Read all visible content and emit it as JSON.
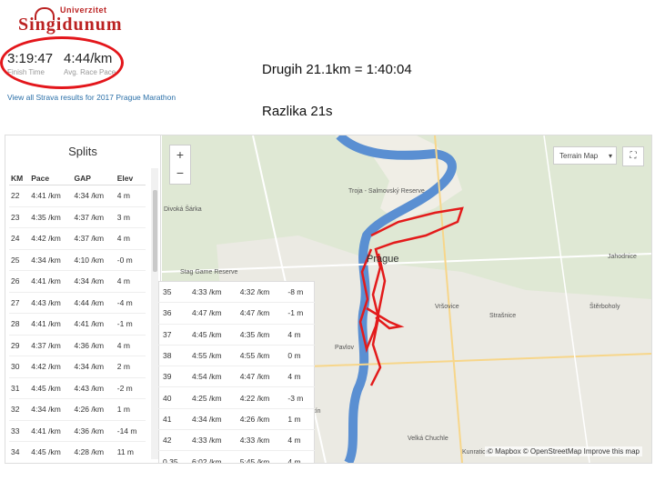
{
  "logo": {
    "top": "Univerzitet",
    "main": "Singidunum"
  },
  "finish": {
    "value": "3:19:47",
    "label": "Finish Time"
  },
  "pace": {
    "value": "4:44/km",
    "label": "Avg. Race Pace"
  },
  "strava_link": "View all Strava results for 2017 Prague Marathon",
  "heading1": "Drugih 21.1km = 1:40:04",
  "heading2": "Razlika 21s",
  "splits": {
    "title": "Splits",
    "columns": [
      "KM",
      "Pace",
      "GAP",
      "Elev"
    ],
    "rows": [
      [
        "22",
        "4:41 /km",
        "4:34 /km",
        "4 m"
      ],
      [
        "23",
        "4:35 /km",
        "4:37 /km",
        "3 m"
      ],
      [
        "24",
        "4:42 /km",
        "4:37 /km",
        "4 m"
      ],
      [
        "25",
        "4:34 /km",
        "4:10 /km",
        "-0 m"
      ],
      [
        "26",
        "4:41 /km",
        "4:34 /km",
        "4 m"
      ],
      [
        "27",
        "4:43 /km",
        "4:44 /km",
        "-4 m"
      ],
      [
        "28",
        "4:41 /km",
        "4:41 /km",
        "-1 m"
      ],
      [
        "29",
        "4:37 /km",
        "4:36 /km",
        "4 m"
      ],
      [
        "30",
        "4:42 /km",
        "4:34 /km",
        "2 m"
      ],
      [
        "31",
        "4:45 /km",
        "4:43 /km",
        "-2 m"
      ],
      [
        "32",
        "4:34 /km",
        "4:26 /km",
        "1 m"
      ],
      [
        "33",
        "4:41 /km",
        "4:36 /km",
        "-14 m"
      ],
      [
        "34",
        "4:45 /km",
        "4:28 /km",
        "11 m"
      ]
    ],
    "overlay_rows": [
      [
        "35",
        "4:33 /km",
        "4:32 /km",
        "-8 m"
      ],
      [
        "36",
        "4:47 /km",
        "4:47 /km",
        "-1 m"
      ],
      [
        "37",
        "4:45 /km",
        "4:35 /km",
        "4 m"
      ],
      [
        "38",
        "4:55 /km",
        "4:55 /km",
        "0 m"
      ],
      [
        "39",
        "4:54 /km",
        "4:47 /km",
        "4 m"
      ],
      [
        "40",
        "4:25 /km",
        "4:22 /km",
        "-3 m"
      ],
      [
        "41",
        "4:34 /km",
        "4:26 /km",
        "1 m"
      ],
      [
        "42",
        "4:33 /km",
        "4:33 /km",
        "4 m"
      ],
      [
        "0.35",
        "6:02 /km",
        "5:45 /km",
        "4 m"
      ]
    ]
  },
  "map": {
    "zoom_in": "+",
    "zoom_out": "−",
    "terrain_label": "Terrain Map",
    "expand_label": "⛶",
    "labels": [
      "Troja - Salmovský Reserve",
      "Divoká Šárka",
      "Stag Game Reserve",
      "Prague",
      "Jahodnice",
      "Štěrboholy",
      "Strašnice",
      "Vršovice",
      "Pavlov",
      "Velká Chuchle",
      "Kunratice",
      "Radotín"
    ],
    "attribution": "© Mapbox © OpenStreetMap Improve this map"
  }
}
